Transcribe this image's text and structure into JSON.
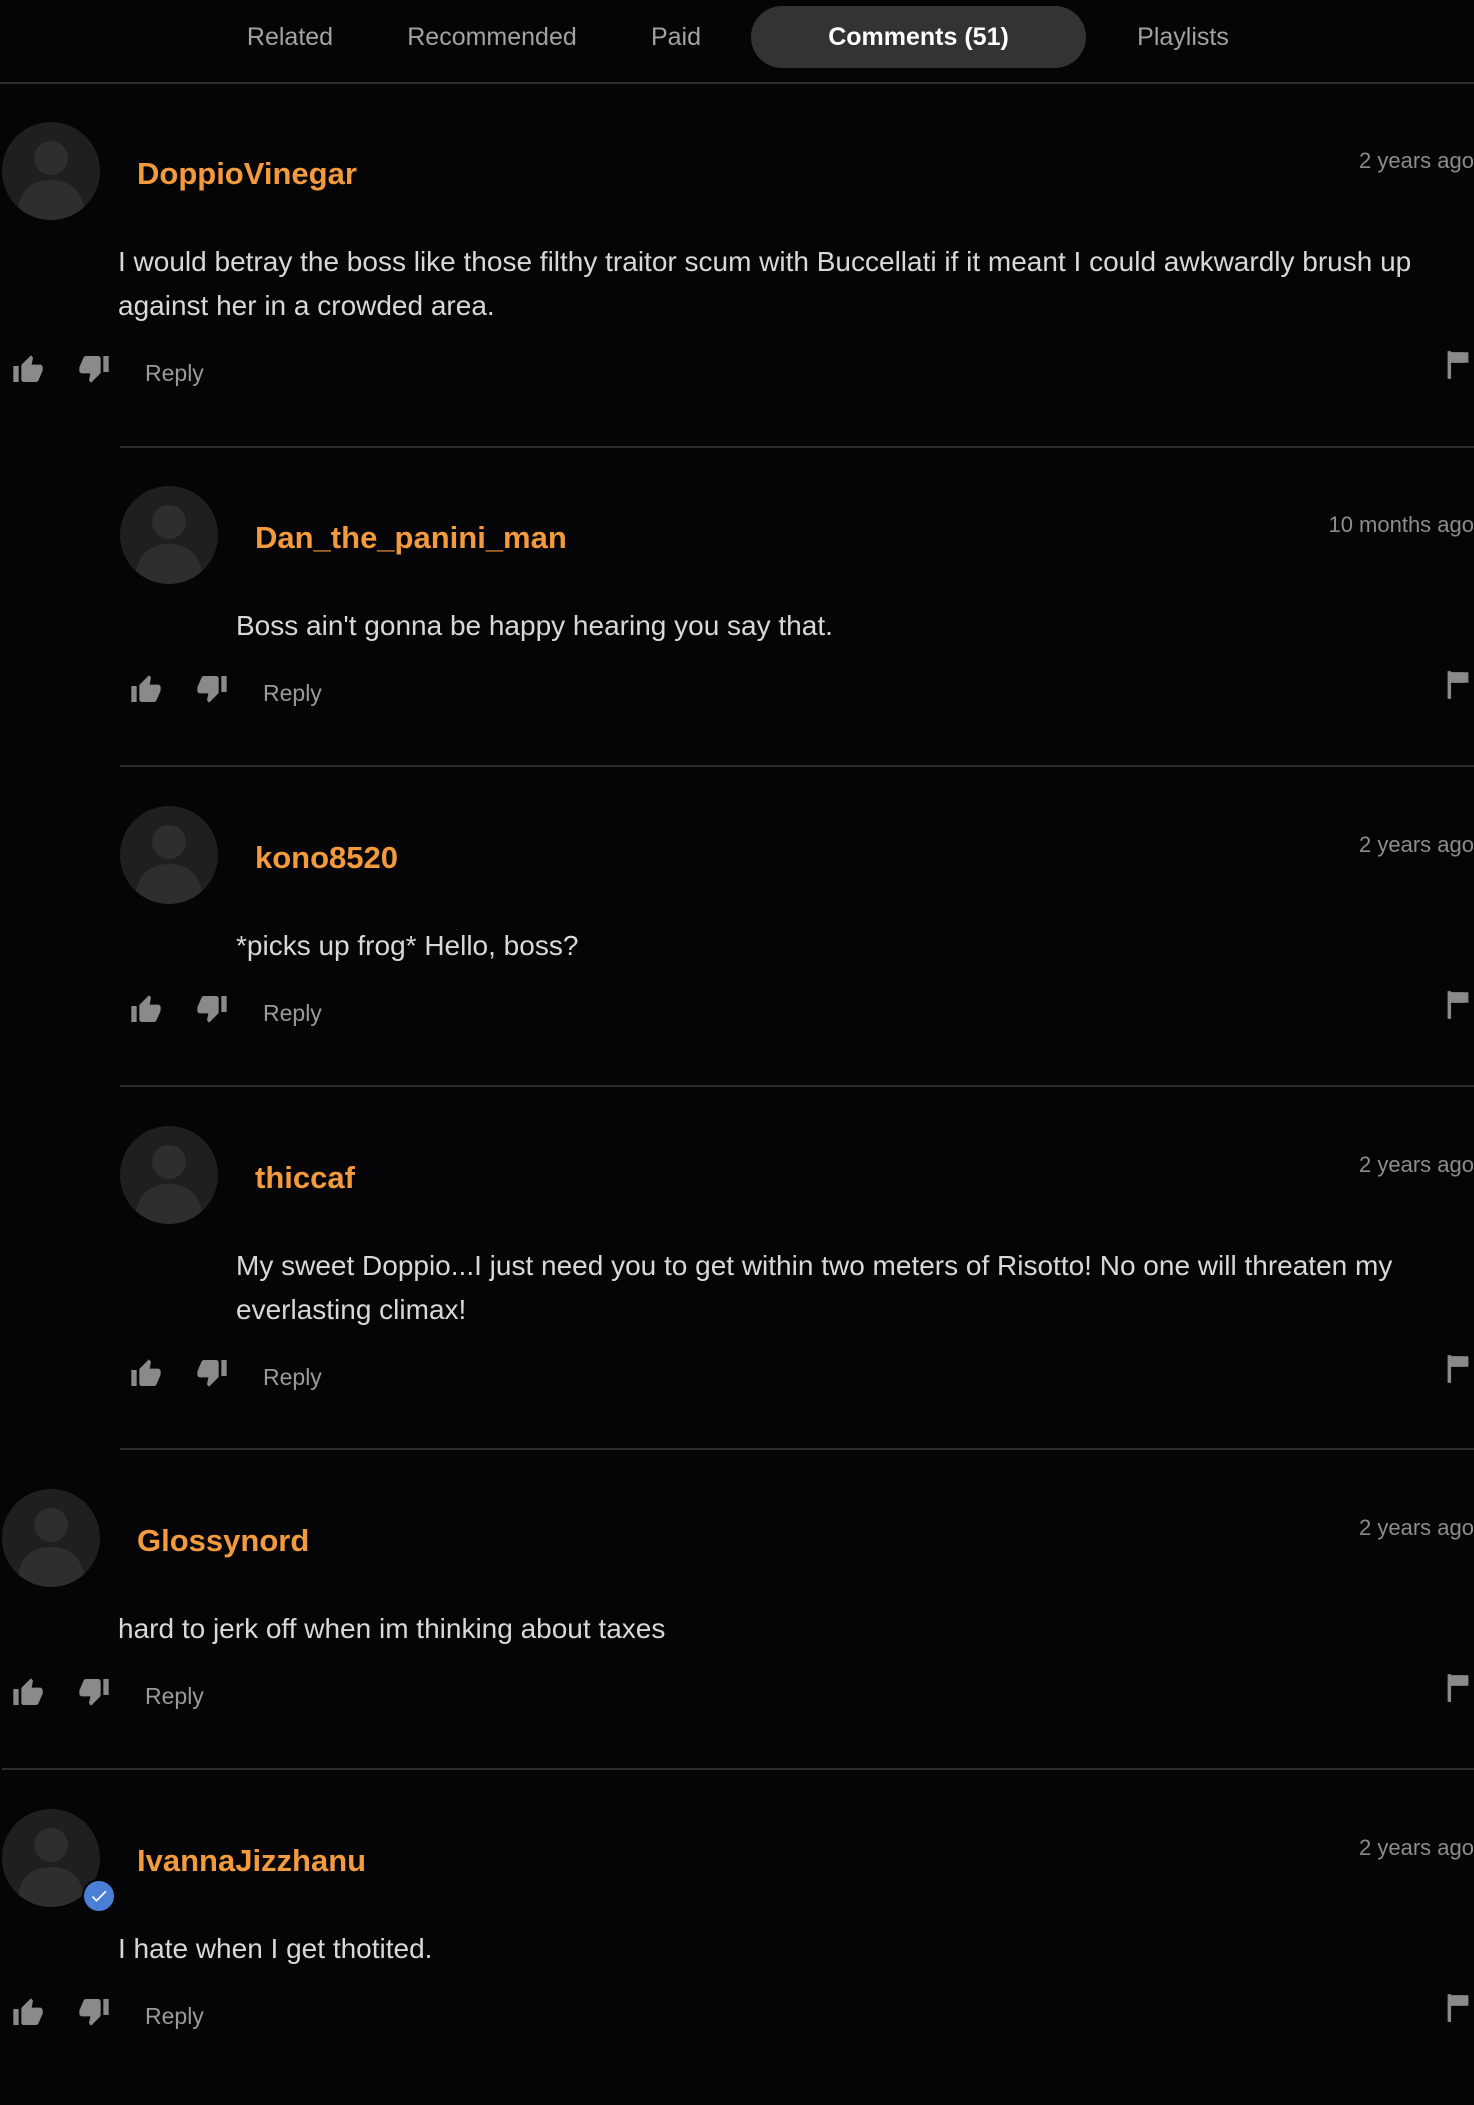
{
  "tabs": [
    {
      "label": "Related",
      "active": false
    },
    {
      "label": "Recommended",
      "active": false
    },
    {
      "label": "Paid",
      "active": false
    },
    {
      "label": "Comments (51)",
      "active": true
    },
    {
      "label": "Playlists",
      "active": false
    }
  ],
  "comments": [
    {
      "username": "DoppioVinegar",
      "time": "2 years ago",
      "text": "I would betray the boss like those filthy traitor scum with Buccellati if it meant I could awkwardly brush up against her in a crowded area.",
      "reply_label": "Reply",
      "is_reply": false,
      "verified": false
    },
    {
      "username": "Dan_the_panini_man",
      "time": "10 months ago",
      "text": "Boss ain't gonna be happy hearing you say that.",
      "reply_label": "Reply",
      "is_reply": true,
      "verified": false
    },
    {
      "username": "kono8520",
      "time": "2 years ago",
      "text": "*picks up frog* Hello, boss?",
      "reply_label": "Reply",
      "is_reply": true,
      "verified": false
    },
    {
      "username": "thiccaf",
      "time": "2 years ago",
      "text": "My sweet Doppio...I just need you to get within two meters of Risotto! No one will threaten my everlasting climax!",
      "reply_label": "Reply",
      "is_reply": true,
      "verified": false
    },
    {
      "username": "Glossynord",
      "time": "2 years ago",
      "text": "hard to jerk off when im thinking about taxes",
      "reply_label": "Reply",
      "is_reply": false,
      "verified": false
    },
    {
      "username": "IvannaJizzhanu",
      "time": "2 years ago",
      "text": "I hate when I get thotited.",
      "reply_label": "Reply",
      "is_reply": false,
      "verified": true
    }
  ],
  "icons": {
    "like": "thumbs-up-icon",
    "dislike": "thumbs-down-icon",
    "flag": "flag-icon",
    "avatar": "default-avatar-icon",
    "verified": "verified-check-icon"
  },
  "colors": {
    "background": "#050507",
    "username": "#f39a3d",
    "active_tab_bg": "#333335",
    "verified_badge": "#4a7fd6"
  }
}
